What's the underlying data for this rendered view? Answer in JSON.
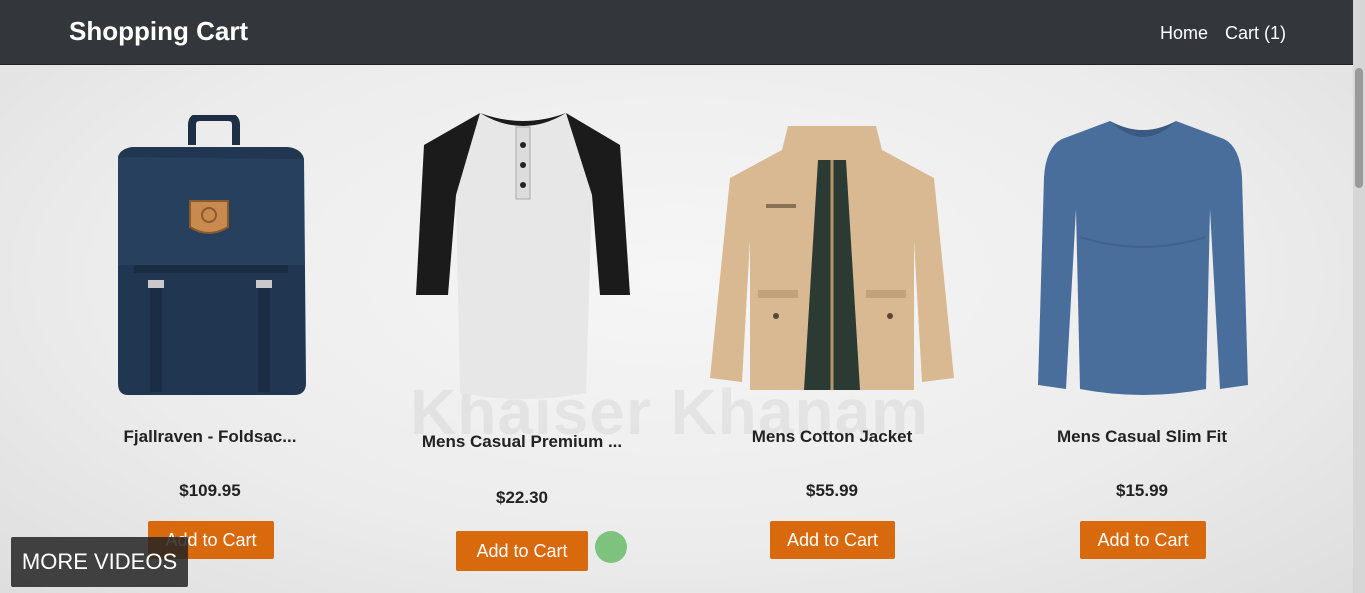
{
  "navbar": {
    "brand": "Shopping Cart",
    "links": {
      "home": "Home",
      "cart": "Cart (1)"
    }
  },
  "products": [
    {
      "title": "Fjallraven - Foldsac...",
      "price": "$109.95",
      "button": "Add to Cart",
      "image_icon": "backpack-icon"
    },
    {
      "title": "Mens Casual Premium ...",
      "price": "$22.30",
      "button": "Add to Cart",
      "image_icon": "raglan-tshirt-icon"
    },
    {
      "title": "Mens Cotton Jacket",
      "price": "$55.99",
      "button": "Add to Cart",
      "image_icon": "jacket-icon"
    },
    {
      "title": "Mens Casual Slim Fit",
      "price": "$15.99",
      "button": "Add to Cart",
      "image_icon": "longsleeve-shirt-icon"
    }
  ],
  "overlay": {
    "watermark": "Khaiser Khanam",
    "more_videos": "MORE VIDEOS"
  },
  "colors": {
    "navbar": "#33373b",
    "button": "#d9690d",
    "text": "#222222"
  }
}
